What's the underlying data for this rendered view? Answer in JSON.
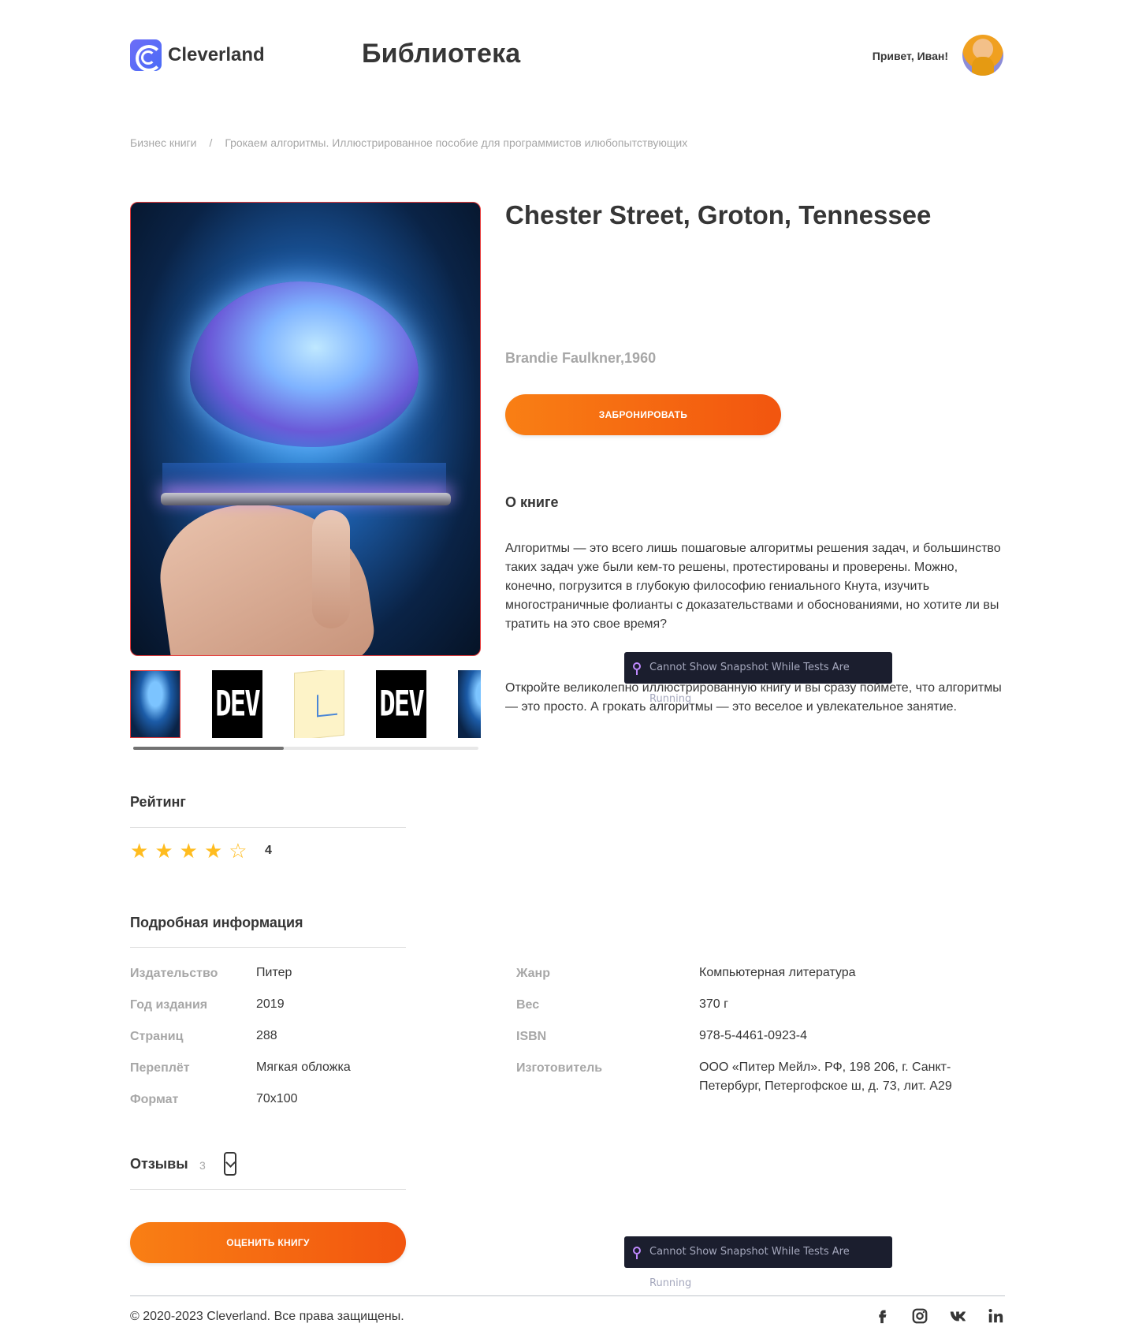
{
  "header": {
    "logo_text": "Cleverland",
    "page_title": "Библиотека",
    "greeting": "Привет, Иван!"
  },
  "breadcrumb": {
    "category": "Бизнес книги",
    "separator": "/",
    "current": "Грокаем алгоритмы. Иллюстрированное пособие для программистов илюбопытствующих"
  },
  "book": {
    "title": "Chester Street, Groton, Tennessee",
    "author": "Brandie Faulkner,1960",
    "book_button": "ЗАБРОНИРОВАТЬ",
    "thumb_dev_label": "DEV"
  },
  "about": {
    "title": "О книге",
    "p1": "Алгоритмы — это всего лишь пошаговые алгоритмы решения задач, и большинство таких задач уже были кем-то решены, протестированы и проверены. Можно, конечно, погрузится в глубокую философию гениального Кнута, изучить многостраничные фолианты с доказательствами и обоснованиями, но хотите ли вы тратить на это свое время?",
    "p2": "Откройте великолепно иллюстрированную книгу и вы сразу поймете, что алгоритмы — это просто. А грокать алгоритмы — это веселое и увлекательное занятие."
  },
  "snapshot_notice": "Cannot Show Snapshot While Tests Are Running",
  "rating": {
    "title": "Рейтинг",
    "value": "4",
    "stars_filled": 4,
    "stars_total": 5
  },
  "details": {
    "title": "Подробная информация",
    "left": [
      {
        "label": "Издательство",
        "value": "Питер"
      },
      {
        "label": "Год издания",
        "value": "2019"
      },
      {
        "label": "Страниц",
        "value": "288"
      },
      {
        "label": "Переплёт",
        "value": "Мягкая обложка"
      },
      {
        "label": "Формат",
        "value": "70х100"
      }
    ],
    "right": [
      {
        "label": "Жанр",
        "value": "Компьютерная литература"
      },
      {
        "label": "Вес",
        "value": "370 г"
      },
      {
        "label": "ISBN",
        "value": "978-5-4461-0923-4"
      },
      {
        "label": "Изготовитель",
        "value": "ООО «Питер Мейл». РФ, 198 206, г. Санкт-Петербург, Петергофское ш, д. 73, лит. А29"
      }
    ]
  },
  "reviews": {
    "title": "Отзывы",
    "count": "3",
    "rate_button": "ОЦЕНИТЬ КНИГУ"
  },
  "footer": {
    "copyright": "© 2020-2023 Cleverland. Все права защищены.",
    "socials": [
      "facebook-icon",
      "instagram-icon",
      "vk-icon",
      "linkedin-icon"
    ]
  },
  "colors": {
    "accent_start": "#f97f14",
    "accent_end": "#f2550f",
    "text_dark": "#363636",
    "text_muted": "#a7a7a7",
    "star": "#ffbc1f"
  }
}
